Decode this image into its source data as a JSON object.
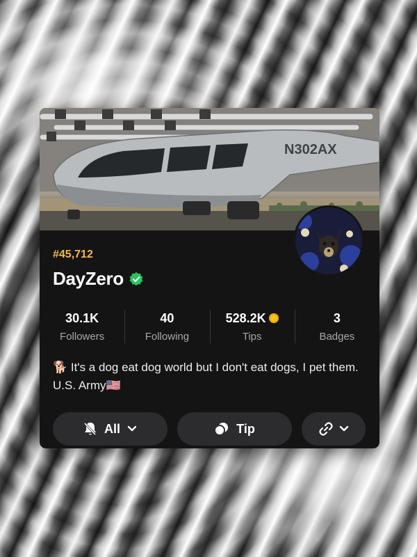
{
  "profile": {
    "rank": "#45,712",
    "name": "DayZero",
    "aircraft_tail": "N302AX",
    "bio": "🐕 It's a dog eat dog world but I don't eat dogs, I pet them. U.S. Army🇺🇸"
  },
  "stats": [
    {
      "value": "30.1K",
      "label": "Followers"
    },
    {
      "value": "40",
      "label": "Following"
    },
    {
      "value": "528.2K",
      "label": "Tips"
    },
    {
      "value": "3",
      "label": "Badges"
    }
  ],
  "actions": {
    "notifications_label": "All",
    "tip_label": "Tip"
  },
  "icons": {
    "verified": "verified-check-icon",
    "coin": "coin-icon",
    "bell": "bell-icon",
    "chevron": "chevron-down-icon",
    "tip": "tip-icon",
    "link": "link-icon"
  },
  "colors": {
    "rank": "#f5b942",
    "verified": "#22c55e",
    "coin": "#f5c518",
    "card_bg": "#141414",
    "button_bg": "#2c2c2e"
  }
}
